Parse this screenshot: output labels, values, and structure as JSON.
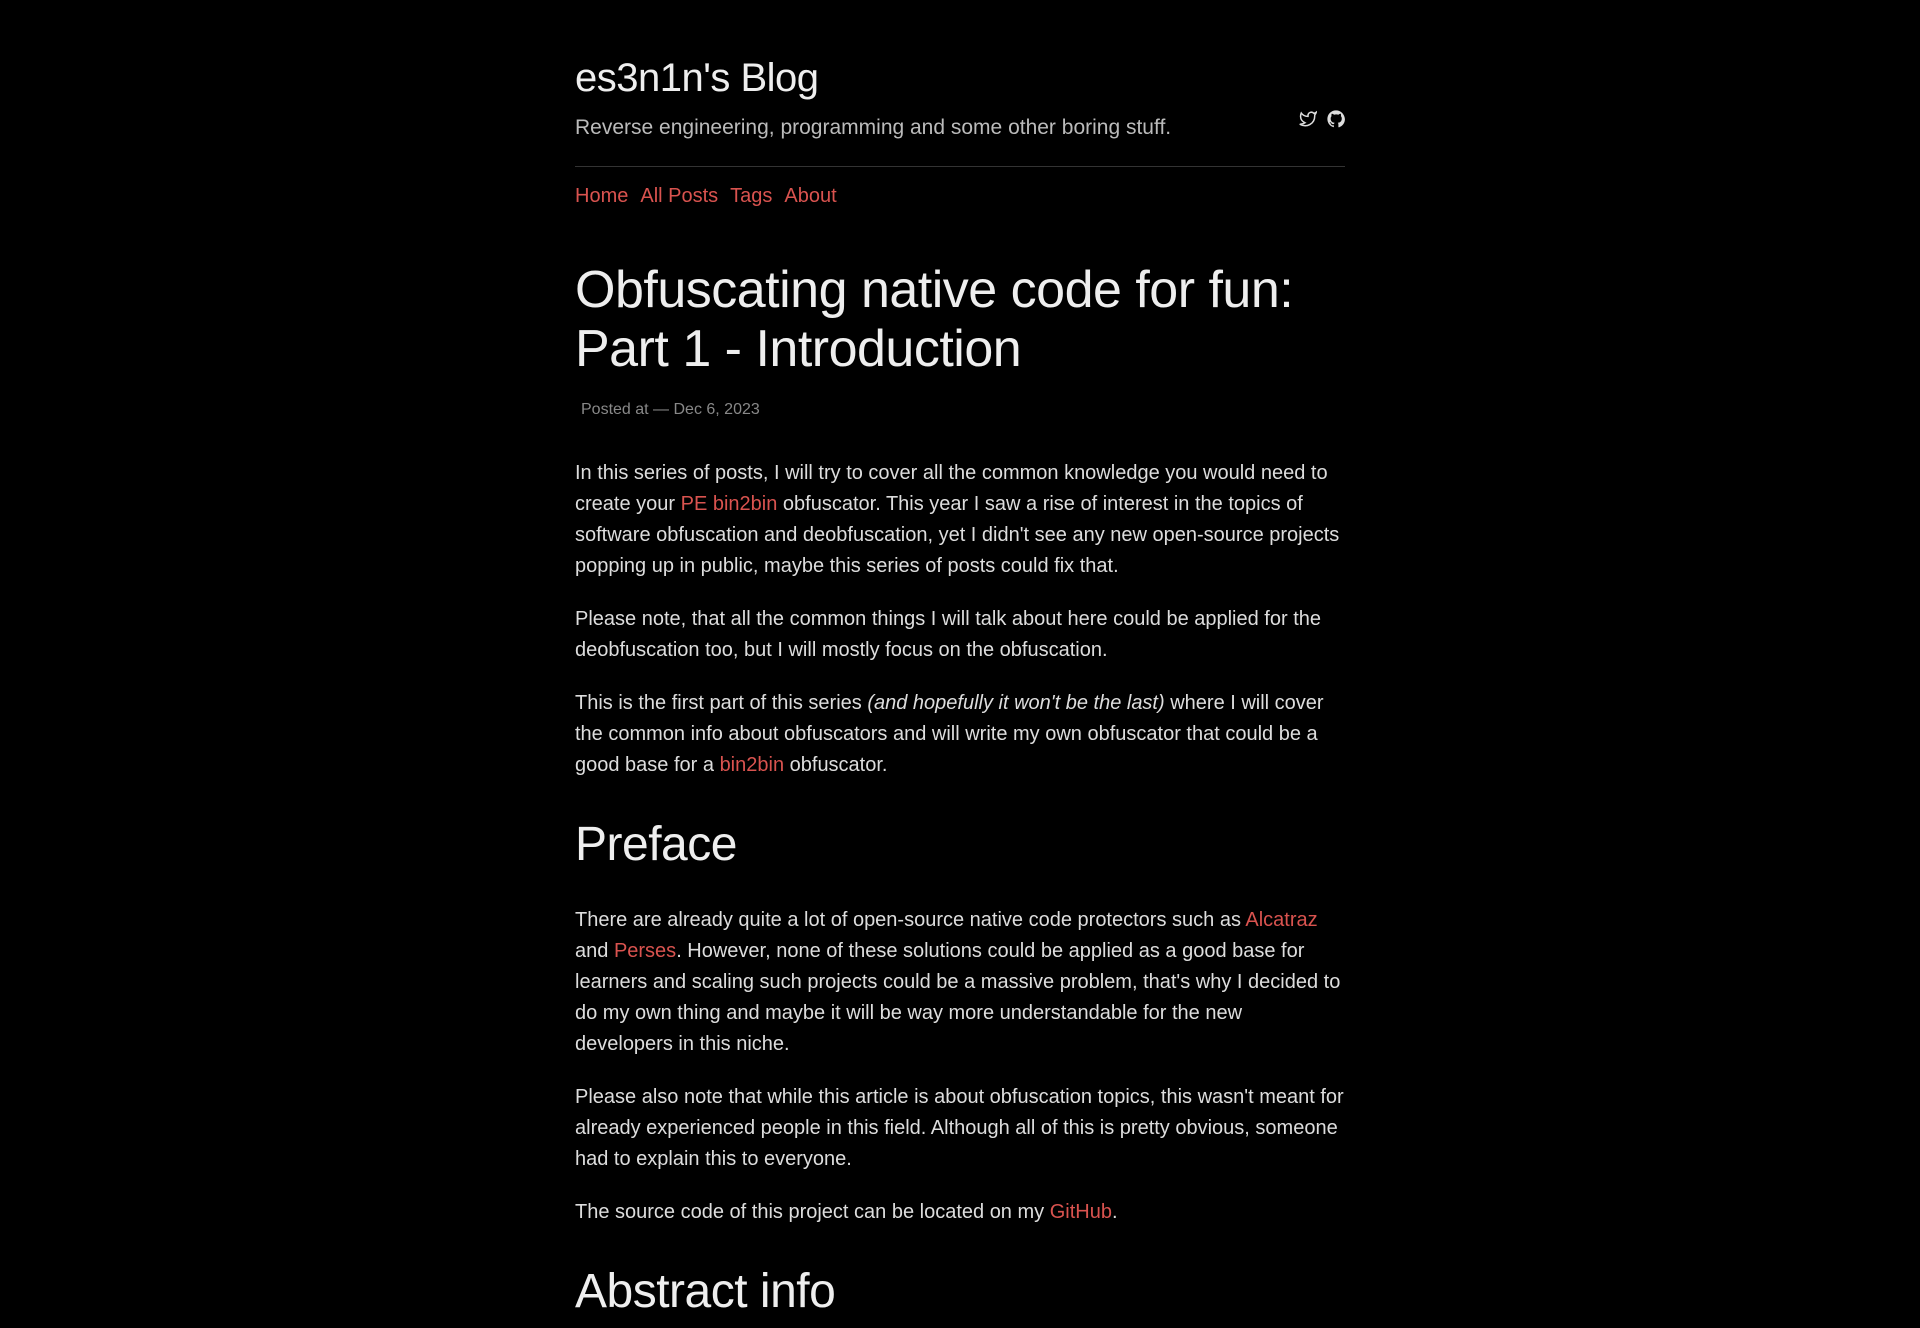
{
  "site": {
    "title": "es3n1n's Blog",
    "tagline": "Reverse engineering, programming and some other boring stuff."
  },
  "nav": {
    "home": "Home",
    "all_posts": "All Posts",
    "tags": "Tags",
    "about": "About"
  },
  "article": {
    "title": "Obfuscating native code for fun: Part 1 - Introduction",
    "meta": "Posted at — Dec 6, 2023",
    "p1_a": "In this series of posts, I will try to cover all the common knowledge you would need to create your ",
    "link_pe": "PE",
    "p1_b": " ",
    "link_bin2bin1": "bin2bin",
    "p1_c": " obfuscator. This year I saw a rise of interest in the topics of software obfuscation and deobfuscation, yet I didn't see any new open-source projects popping up in public, maybe this series of posts could fix that.",
    "p2": "Please note, that all the common things I will talk about here could be applied for the deobfuscation too, but I will mostly focus on the obfuscation.",
    "p3_a": "This is the first part of this series ",
    "p3_em": "(and hopefully it won't be the last)",
    "p3_b": " where I will cover the common info about obfuscators and will write my own obfuscator that could be a good base for a ",
    "link_bin2bin2": "bin2bin",
    "p3_c": " obfuscator.",
    "h_preface": "Preface",
    "p4_a": "There are already quite a lot of open-source native code protectors such as ",
    "link_alcatraz": "Alcatraz",
    "p4_b": " and ",
    "link_perses": "Perses",
    "p4_c": ". However, none of these solutions could be applied as a good base for learners and scaling such projects could be a massive problem, that's why I decided to do my own thing and maybe it will be way more understandable for the new developers in this niche.",
    "p5": "Please also note that while this article is about obfuscation topics, this wasn't meant for already experienced people in this field. Although all of this is pretty obvious, someone had to explain this to everyone.",
    "p6_a": "The source code of this project can be located on my ",
    "link_github": "GitHub",
    "p6_b": ".",
    "h_abstract": "Abstract info"
  }
}
